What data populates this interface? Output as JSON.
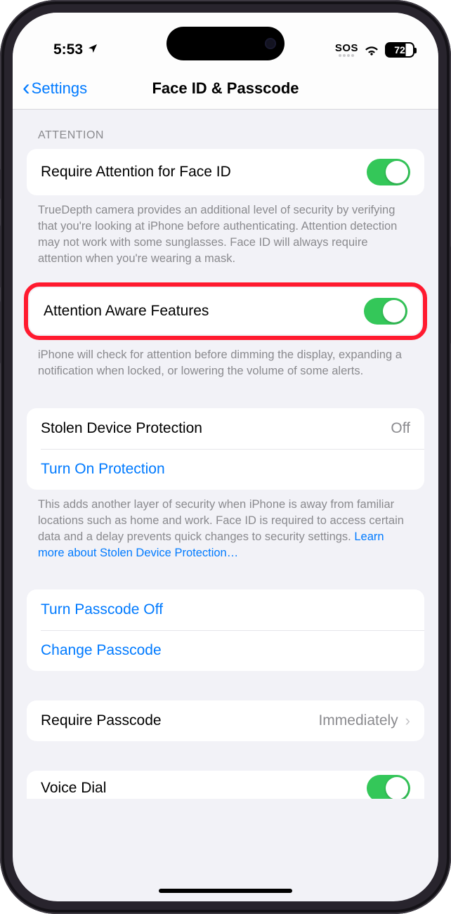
{
  "status": {
    "time": "5:53",
    "sos": "SOS",
    "battery_pct": "72"
  },
  "nav": {
    "back_label": "Settings",
    "title": "Face ID & Passcode"
  },
  "sections": {
    "attention_header": "ATTENTION",
    "require_attention": {
      "label": "Require Attention for Face ID",
      "on": true,
      "footer": "TrueDepth camera provides an additional level of security by verifying that you're looking at iPhone before authenticating. Attention detection may not work with some sunglasses. Face ID will always require attention when you're wearing a mask."
    },
    "attention_aware": {
      "label": "Attention Aware Features",
      "on": true,
      "footer": "iPhone will check for attention before dimming the display, expanding a notification when locked, or lowering the volume of some alerts."
    },
    "stolen": {
      "label": "Stolen Device Protection",
      "value": "Off",
      "action": "Turn On Protection",
      "footer_a": "This adds another layer of security when iPhone is away from familiar locations such as home and work. Face ID is required to access certain data and a delay prevents quick changes to security settings. ",
      "footer_link": "Learn more about Stolen Device Protection…"
    },
    "passcode": {
      "turn_off": "Turn Passcode Off",
      "change": "Change Passcode"
    },
    "require_passcode": {
      "label": "Require Passcode",
      "value": "Immediately"
    },
    "voice_dial": {
      "label": "Voice Dial",
      "on": true
    }
  }
}
